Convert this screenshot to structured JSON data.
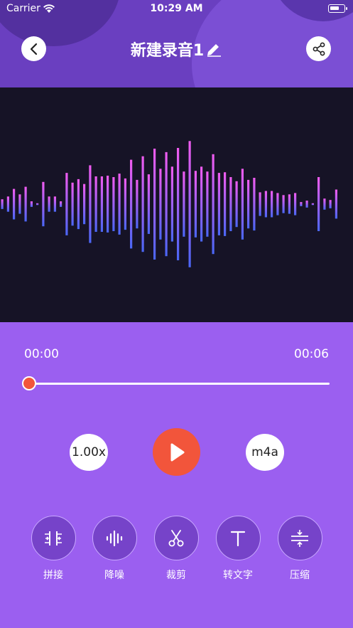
{
  "status_bar": {
    "carrier": "Carrier",
    "time": "10:29 AM"
  },
  "header": {
    "title": "新建录音1"
  },
  "player": {
    "current_time": "00:00",
    "total_time": "00:06",
    "progress": 0,
    "speed": "1.00x",
    "format": "m4a"
  },
  "tools": [
    {
      "label": "拼接",
      "icon": "merge-icon"
    },
    {
      "label": "降噪",
      "icon": "noise-reduction-icon"
    },
    {
      "label": "裁剪",
      "icon": "scissors-icon"
    },
    {
      "label": "转文字",
      "icon": "text-icon"
    },
    {
      "label": "压缩",
      "icon": "compress-icon"
    }
  ],
  "colors": {
    "header_bg": "#6a3fc0",
    "body_bg": "#9b5ff0",
    "waveform_bg": "#161326",
    "wave_top": "#f15bf0",
    "wave_bottom": "#4a66f5",
    "accent": "#f2553b"
  },
  "waveform_levels": [
    0.07,
    0.11,
    0.22,
    0.14,
    0.25,
    0.04,
    0.01,
    0.32,
    0.11,
    0.11,
    0.04,
    0.45,
    0.31,
    0.36,
    0.29,
    0.56,
    0.4,
    0.4,
    0.41,
    0.39,
    0.44,
    0.37,
    0.64,
    0.35,
    0.69,
    0.43,
    0.8,
    0.51,
    0.75,
    0.54,
    0.81,
    0.47,
    0.91,
    0.48,
    0.54,
    0.47,
    0.72,
    0.45,
    0.46,
    0.39,
    0.33,
    0.51,
    0.35,
    0.38,
    0.17,
    0.19,
    0.19,
    0.16,
    0.13,
    0.14,
    0.16,
    0.03,
    0.05,
    0.0,
    0.39,
    0.08,
    0.06,
    0.21
  ]
}
